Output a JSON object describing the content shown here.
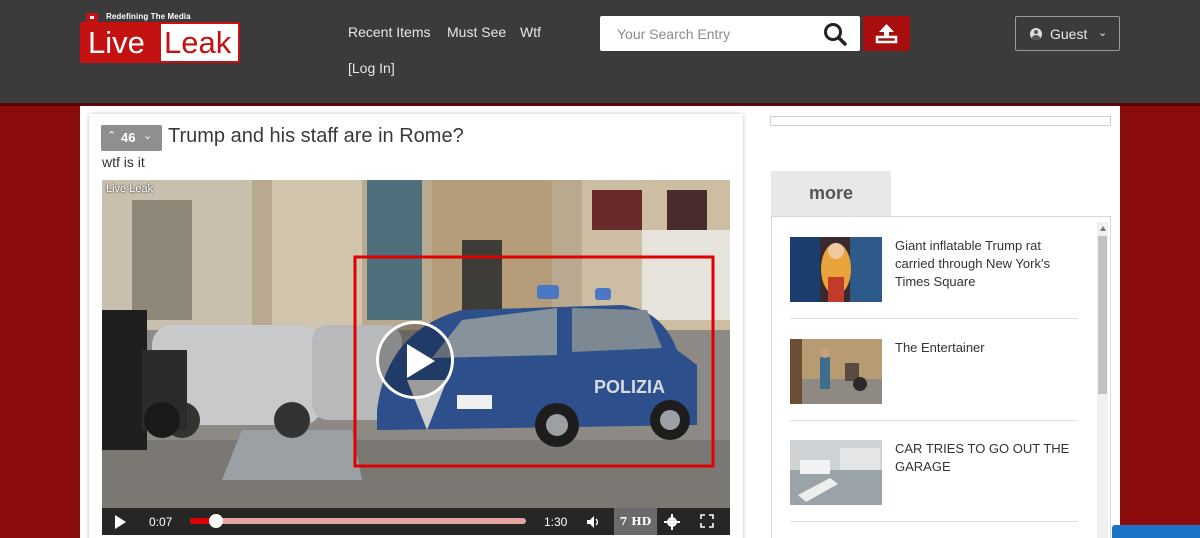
{
  "logo": {
    "tagline": "Redefining The Media",
    "word1": "Live",
    "word2": "Leak"
  },
  "nav": {
    "items": [
      "Recent Items",
      "Must See",
      "Wtf"
    ],
    "login": "[Log In]"
  },
  "search": {
    "placeholder": "Your Search Entry",
    "icon": "search-icon"
  },
  "upload": {
    "icon": "upload-icon"
  },
  "user": {
    "label": "Guest",
    "icon": "user-circle-icon"
  },
  "post": {
    "votes": "46",
    "title": "Trump and his staff are in Rome?",
    "description": "wtf is it"
  },
  "player": {
    "watermark": "Live Leak",
    "current_time": "0:07",
    "duration": "1:30",
    "progress_fraction": 0.078,
    "quality": "7 HD"
  },
  "sidebar": {
    "tab": "more",
    "items": [
      {
        "title": "Giant inflatable Trump rat carried through New York's Times Square"
      },
      {
        "title": "The Entertainer"
      },
      {
        "title": "CAR TRIES TO GO OUT THE GARAGE"
      }
    ]
  },
  "colors": {
    "header": "#3b3b3b",
    "brand_red": "#c41212",
    "page_bg": "#8a0c0c"
  }
}
